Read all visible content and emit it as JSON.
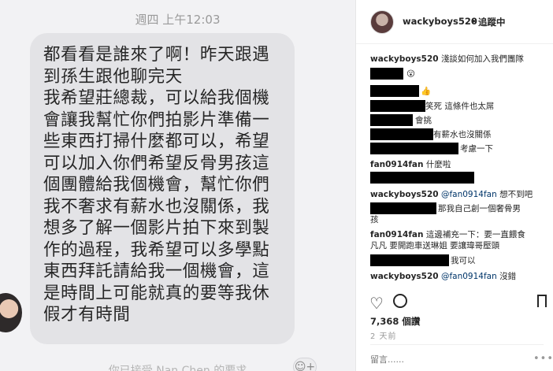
{
  "chat": {
    "timestamp": "週四 上午12:03",
    "message": "都看看是誰來了啊！昨天跟遇\n到孫生跟他聊完天\n我希望莊總裁，可以給我個機\n會讓我幫忙你們拍影片準備一\n些東西打掃什麼都可以，希望\n可以加入你們希望反骨男孩這\n個團體給我個機會，幫忙你們\n我不奢求有薪水也沒關係，我\n想多了解一個影片拍下來到製\n作的過程，我希望可以多學點\n東西拜託請給我一個機會，這\n是時間上可能就真的要等我休\n假才有時間",
    "reaction_glyph": "☺+",
    "footer": "你已接受 Nan Chen 的要求"
  },
  "instagram": {
    "username": "wackyboys520",
    "separator": "•",
    "follow_label": "追蹤中",
    "comments": [
      {
        "user": "wackyboys520",
        "text": "淺談如何加入我們團隊"
      },
      {
        "user": "",
        "text": "😮"
      },
      {
        "user": "",
        "text": "👍"
      },
      {
        "user": "",
        "text": "笑死 這條件也太屌"
      },
      {
        "user": "",
        "text": "會挑"
      },
      {
        "user": "",
        "text": "有薪水也沒關係"
      },
      {
        "user": "",
        "text": "考慮一下"
      },
      {
        "user": "fan0914fan",
        "text": "什麼啦"
      },
      {
        "user": "wackyboys520",
        "mention": "@fan0914fan",
        "text": "想不到吧"
      },
      {
        "user": "",
        "text": "那我自己創一個奢骨男",
        "text2": "孩"
      },
      {
        "user": "fan0914fan",
        "text": "這邊補充一下：要一直餵食",
        "text2": "凡凡 要開跑車送琳姐 要讓瑋哥壓頭"
      },
      {
        "user": "",
        "text": "我可以"
      },
      {
        "user": "wackyboys520",
        "mention": "@fan0914fan",
        "text": "沒錯"
      }
    ],
    "heart_glyph": "♡",
    "likes": "7,368 個讚",
    "post_time": "2 天前",
    "comment_placeholder": "留言......",
    "more_glyph": "•••"
  }
}
